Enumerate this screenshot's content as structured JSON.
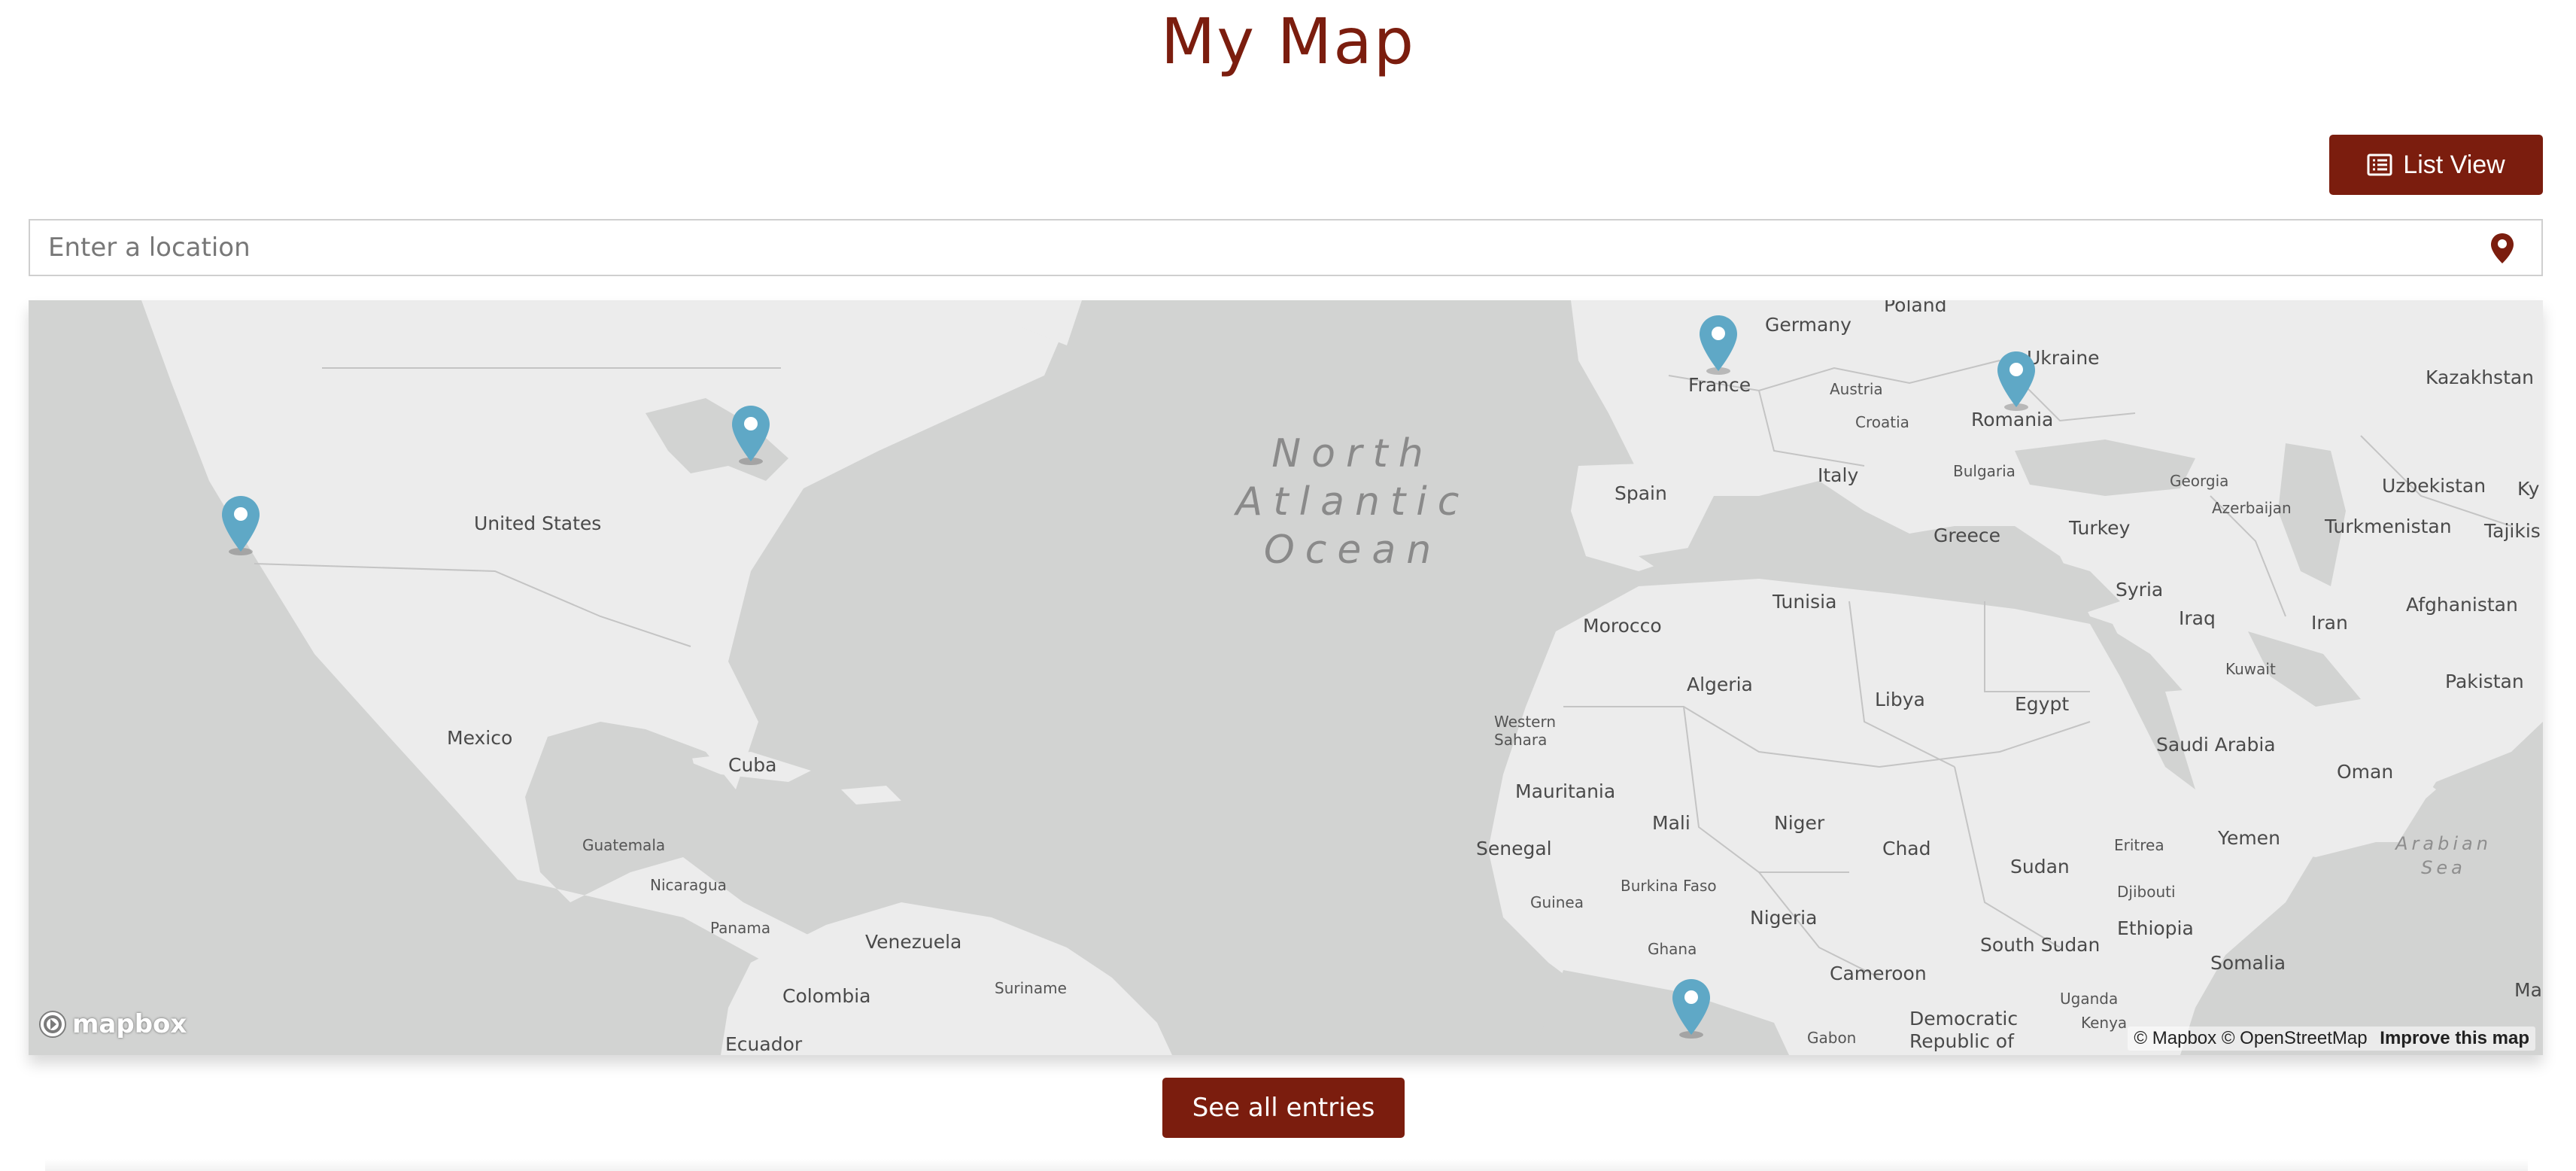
{
  "page": {
    "title": "My Map"
  },
  "toolbar": {
    "list_view_label": "List View",
    "list_icon": "list-icon"
  },
  "search": {
    "placeholder": "Enter a location",
    "icon": "map-pin-icon"
  },
  "map": {
    "provider_logo": "mapbox",
    "ocean_label": "North\nAtlantic\nOcean",
    "sea_label": "Arabian\nSea",
    "labels": {
      "united_states": "United States",
      "mexico": "Mexico",
      "cuba": "Cuba",
      "guatemala": "Guatemala",
      "nicaragua": "Nicaragua",
      "panama": "Panama",
      "venezuela": "Venezuela",
      "suriname": "Suriname",
      "colombia": "Colombia",
      "ecuador": "Ecuador",
      "poland": "Poland",
      "germany": "Germany",
      "france": "France",
      "austria": "Austria",
      "croatia": "Croatia",
      "ukraine": "Ukraine",
      "romania": "Romania",
      "bulgaria": "Bulgaria",
      "spain": "Spain",
      "italy": "Italy",
      "greece": "Greece",
      "turkey": "Turkey",
      "georgia": "Georgia",
      "azerbaijan": "Azerbaijan",
      "kazakhstan": "Kazakhstan",
      "uzbekistan": "Uzbekistan",
      "ky": "Ky",
      "turkmenistan": "Turkmenistan",
      "tajikistan": "Tajikis",
      "afghanistan": "Afghanistan",
      "iran": "Iran",
      "iraq": "Iraq",
      "syria": "Syria",
      "kuwait": "Kuwait",
      "pakistan": "Pakistan",
      "saudi_arabia": "Saudi Arabia",
      "oman": "Oman",
      "yemen": "Yemen",
      "tunisia": "Tunisia",
      "morocco": "Morocco",
      "algeria": "Algeria",
      "libya": "Libya",
      "egypt": "Egypt",
      "western_sahara": "Western\nSahara",
      "mauritania": "Mauritania",
      "mali": "Mali",
      "niger": "Niger",
      "chad": "Chad",
      "sudan": "Sudan",
      "eritrea": "Eritrea",
      "djibouti": "Djibouti",
      "senegal": "Senegal",
      "guinea": "Guinea",
      "burkina_faso": "Burkina Faso",
      "nigeria": "Nigeria",
      "ghana": "Ghana",
      "cameroon": "Cameroon",
      "ethiopia": "Ethiopia",
      "south_sudan": "South Sudan",
      "somalia": "Somalia",
      "uganda": "Uganda",
      "kenya": "Kenya",
      "gabon": "Gabon",
      "drc": "Democratic\nRepublic of",
      "ma": "Ma"
    },
    "markers": [
      {
        "name": "marker-california",
        "color": "#5fa8c6"
      },
      {
        "name": "marker-toronto",
        "color": "#5fa8c6"
      },
      {
        "name": "marker-paris",
        "color": "#5fa8c6"
      },
      {
        "name": "marker-ukraine",
        "color": "#5fa8c6"
      },
      {
        "name": "marker-gulf-of-guinea",
        "color": "#5fa8c6"
      }
    ],
    "attribution": {
      "mapbox": "© Mapbox",
      "osm": "© OpenStreetMap",
      "improve": "Improve this map"
    }
  },
  "footer": {
    "see_all_label": "See all entries"
  },
  "colors": {
    "brand": "#7b1d0e",
    "marker": "#5fa8c6",
    "water": "#d2d3d2",
    "land": "#ececec"
  }
}
